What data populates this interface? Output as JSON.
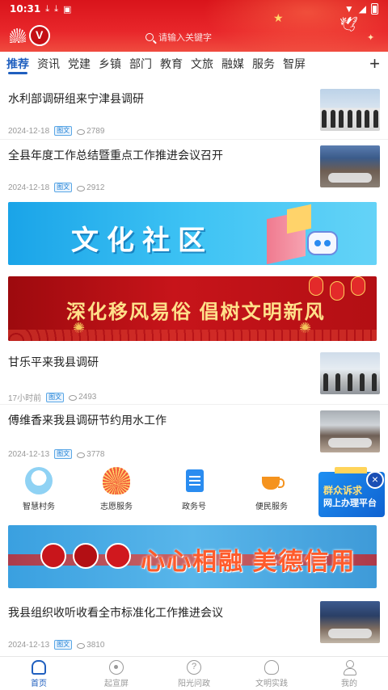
{
  "status_bar": {
    "time": "10:31"
  },
  "header": {
    "search_placeholder": "请输入关键字"
  },
  "tabs": [
    "推荐",
    "资讯",
    "党建",
    "乡镇",
    "部门",
    "教育",
    "文旅",
    "融媒",
    "服务",
    "智屏"
  ],
  "tab_add": "+",
  "news": [
    {
      "title": "水利部调研组来宁津县调研",
      "date": "2024-12-18",
      "tag": "图文",
      "views": "2789"
    },
    {
      "title": "全县年度工作总结暨重点工作推进会议召开",
      "date": "2024-12-18",
      "tag": "图文",
      "views": "2912"
    },
    {
      "title": "甘乐平来我县调研",
      "date": "17小时前",
      "tag": "图文",
      "views": "2493"
    },
    {
      "title": "傅维香来我县调研节约用水工作",
      "date": "2024-12-13",
      "tag": "图文",
      "views": "3778"
    },
    {
      "title": "我县组织收听收看全市标准化工作推进会议",
      "date": "2024-12-13",
      "tag": "图文",
      "views": "3810"
    }
  ],
  "banners": {
    "culture": "文化社区",
    "customs": "深化移风易俗 倡树文明新风",
    "virtue": "心心相融 美德信用"
  },
  "services": [
    "智慧村务",
    "志愿服务",
    "政务号",
    "便民服务"
  ],
  "float_ad": {
    "line1": "群众诉求",
    "line2": "网上办理平台",
    "close": "×"
  },
  "bottom_nav": [
    "首页",
    "起宣屏",
    "阳光问政",
    "文明实践",
    "我的"
  ],
  "colors": {
    "brand_red": "#e8262a",
    "accent_blue": "#1f5fbf"
  }
}
